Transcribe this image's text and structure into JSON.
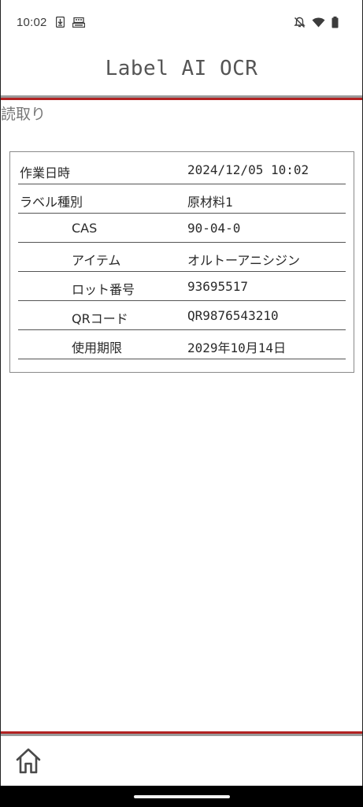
{
  "status_bar": {
    "time": "10:02",
    "left_icons": [
      "download-status-icon",
      "keyboard-status-icon"
    ],
    "right_icons": [
      "mute-icon",
      "wifi-icon",
      "battery-icon"
    ]
  },
  "header": {
    "title": "Label AI OCR"
  },
  "section": {
    "title": "読取り"
  },
  "table": {
    "rows": [
      {
        "label": "作業日時",
        "value": "2024/12/05 10:02"
      },
      {
        "label": "ラベル種別",
        "value": "原材料1"
      },
      {
        "label": "CAS",
        "value": "90-04-0"
      },
      {
        "label": "アイテム",
        "value": "オルトーアニシジン"
      },
      {
        "label": "ロット番号",
        "value": "93695517"
      },
      {
        "label": "QRコード",
        "value": "QR9876543210"
      },
      {
        "label": "使用期限",
        "value": "2029年10月14日"
      }
    ]
  },
  "colors": {
    "accent_red": "#b22222",
    "rule_gray": "#9a9a9a",
    "text": "#2a2a2a"
  },
  "nav": {
    "home_icon": "home-icon"
  }
}
